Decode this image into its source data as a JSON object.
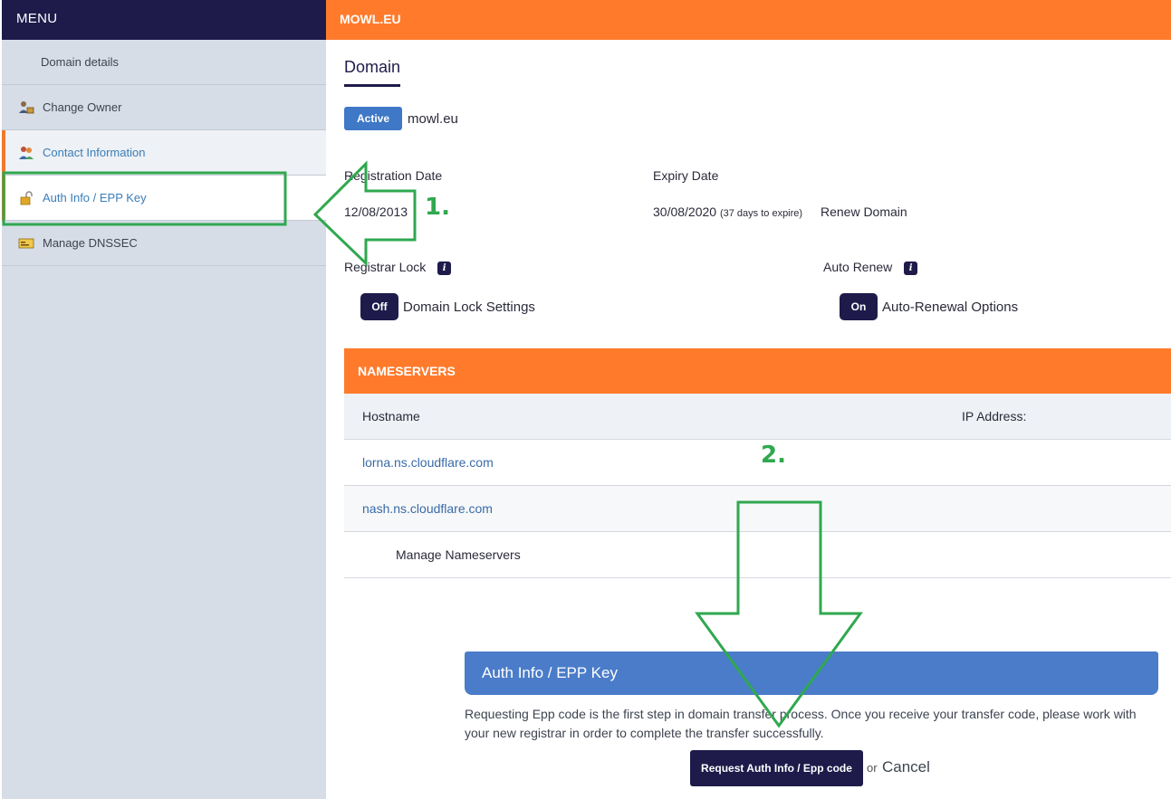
{
  "menu": {
    "title": "MENU",
    "items": [
      {
        "label": "Domain details",
        "icon": "none"
      },
      {
        "label": "Change Owner",
        "icon": "owner-icon"
      },
      {
        "label": "Contact Information",
        "icon": "contacts-icon"
      },
      {
        "label": "Auth Info / EPP Key",
        "icon": "lock-icon"
      },
      {
        "label": "Manage DNSSEC",
        "icon": "dnssec-icon"
      }
    ]
  },
  "topbar": {
    "title": "MOWL.EU"
  },
  "domain": {
    "tab_label": "Domain",
    "status": "Active",
    "name": "mowl.eu",
    "registration_label": "Registration Date",
    "registration_date": "12/08/2013",
    "expiry_label": "Expiry Date",
    "expiry_date": "30/08/2020",
    "expiry_note": "(37 days to expire)",
    "renew_link": "Renew Domain",
    "registrar_lock_label": "Registrar Lock",
    "registrar_lock_state": "Off",
    "registrar_lock_link": "Domain Lock Settings",
    "auto_renew_label": "Auto Renew",
    "auto_renew_state": "On",
    "auto_renew_link": "Auto-Renewal Options",
    "info_glyph": "i"
  },
  "nameservers": {
    "title": "NAMESERVERS",
    "col_hostname": "Hostname",
    "col_ip": "IP Address:",
    "rows": [
      "lorna.ns.cloudflare.com",
      "nash.ns.cloudflare.com"
    ],
    "manage_label": "Manage Nameservers"
  },
  "auth": {
    "title": "Auth Info / EPP Key",
    "description": "Requesting Epp code is the first step in domain transfer process. Once you receive your transfer code, please work with your new registrar in order to complete the transfer successfully.",
    "request_button": "Request Auth Info / Epp code",
    "or_text": "or",
    "cancel_link": "Cancel"
  },
  "annotations": {
    "step1": "1.",
    "step2": "2.",
    "color": "#2fa84f"
  }
}
